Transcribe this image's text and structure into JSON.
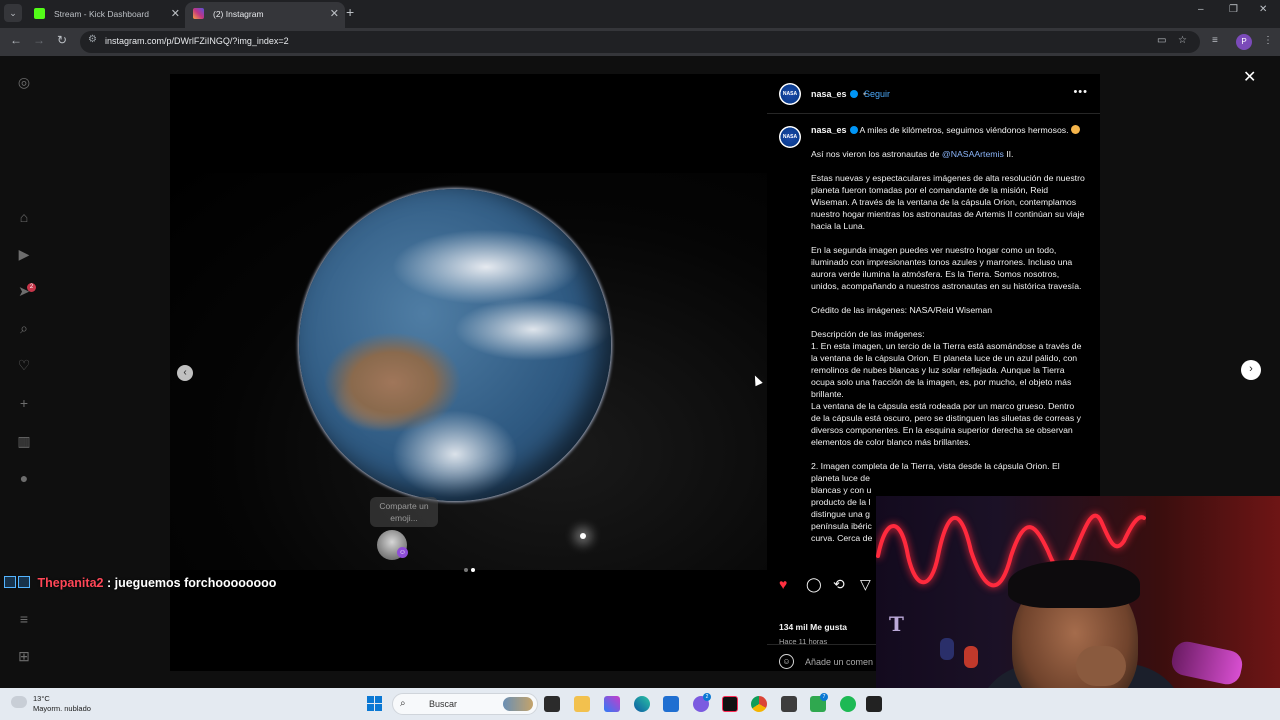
{
  "browser": {
    "tabs": [
      {
        "title": "Stream - Kick Dashboard",
        "favicon_color": "#53fc18"
      },
      {
        "title": "(2) Instagram",
        "favicon_color": "#c13584"
      }
    ],
    "new_tab": "+",
    "url": "instagram.com/p/DWrlFZiINGQ/?img_index=2",
    "profile_initial": "P",
    "window_controls": {
      "minimize": "–",
      "restore": "❐",
      "close": "✕"
    }
  },
  "instagram": {
    "sidebar_icons": [
      "instagram-icon",
      "home-icon",
      "reels-icon",
      "messages-icon",
      "search-icon",
      "heart-icon",
      "create-icon",
      "dashboard-icon",
      "profile-icon",
      "menu-icon",
      "more-icon"
    ],
    "notification_count": "2",
    "media": {
      "prev": "‹",
      "emoji_tooltip": "Comparte un emoji...",
      "slide_count": 2,
      "current_slide": 2
    },
    "post": {
      "username": "nasa_es",
      "avatar_text": "NASA",
      "separator": "•",
      "follow": "Seguir",
      "more": "•••",
      "caption": {
        "intro": "A miles de kilómetros, seguimos viéndonos hermosos.",
        "p1_pre": "Así nos vieron los astronautas de",
        "p1_mention": "@NASAArtemis",
        "p1_post": "II.",
        "p2": "Estas nuevas y espectaculares imágenes de alta resolución de nuestro planeta fueron tomadas por el comandante de la misión, Reid Wiseman. A través de la ventana de la cápsula Orion, contemplamos nuestro hogar mientras los astronautas de Artemis II continúan su viaje hacia la Luna.",
        "p3": "En la segunda imagen puedes ver nuestro hogar como un todo, iluminado con impresionantes tonos azules y marrones. Incluso una aurora verde ilumina la atmósfera. Es la Tierra. Somos nosotros, unidos, acompañando a nuestros astronautas en su histórica travesía.",
        "p4": "Crédito de las imágenes: NASA/Reid Wiseman",
        "p5_title": "Descripción de las imágenes:",
        "p5_body": "1. En esta imagen, un tercio de la Tierra está asomándose a través de la ventana de la cápsula Orion. El planeta luce de un azul pálido, con remolinos de nubes blancas y luz solar reflejada. Aunque la Tierra ocupa solo una fracción de la imagen, es, por mucho, el objeto más brillante.",
        "p5_body2": "La ventana de la cápsula está rodeada por un marco grueso. Dentro de la cápsula está oscuro, pero se distinguen las siluetas de correas y diversos componentes. En la esquina superior derecha se observan elementos de color blanco más brillantes.",
        "p6": "2. Imagen completa de la Tierra, vista desde la cápsula Orion. El planeta luce de",
        "p6_l2": "blancas y con u",
        "p6_l3": "producto de la l",
        "p6_l4": "distingue una g",
        "p6_l5": "península ibéric",
        "p6_l6": "curva. Cerca de"
      },
      "likes": "134 mil Me gusta",
      "time": "Hace 11 horas",
      "comment_placeholder": "Añade un comen"
    },
    "close": "✕",
    "next": "›"
  },
  "stream_chat": {
    "username": "Thepanita2",
    "separator": ":",
    "message": "jueguemos forchoooooooo"
  },
  "taskbar": {
    "weather_temp": "13°C",
    "weather_desc": "Mayorm. nublado",
    "search_placeholder": "Buscar",
    "app_badges": [
      "2",
      "7"
    ]
  }
}
